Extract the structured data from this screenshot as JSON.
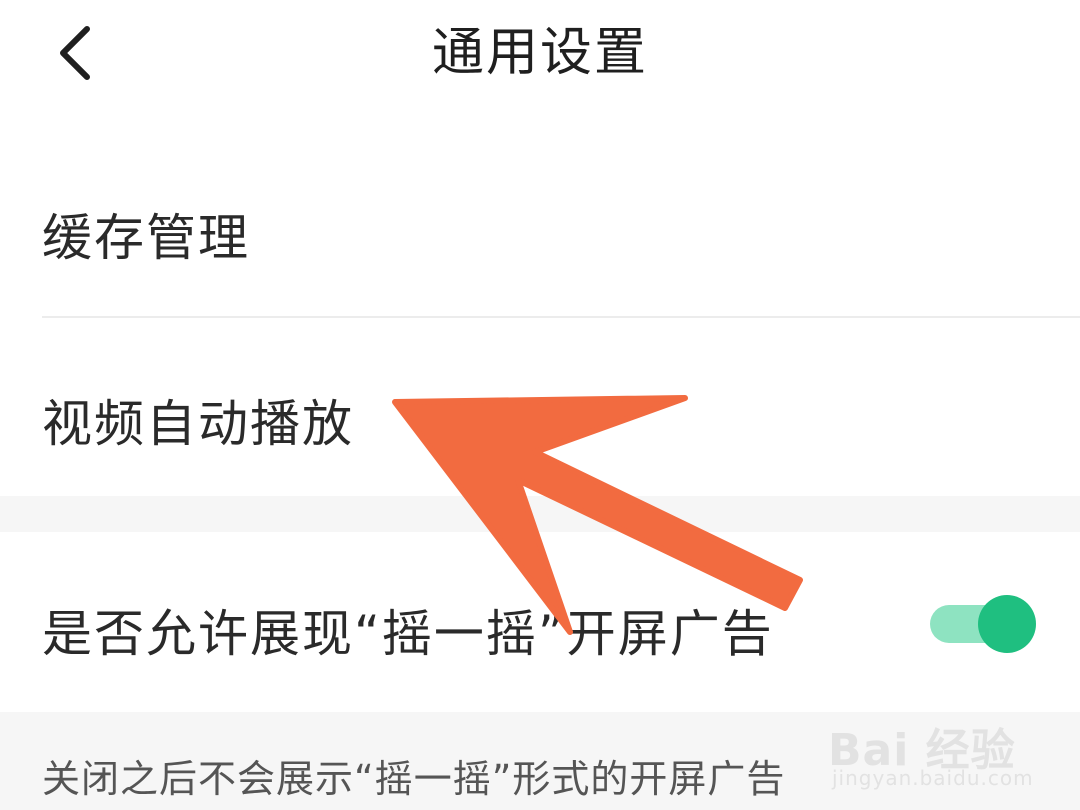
{
  "header": {
    "title": "通用设置",
    "back_icon": "chevron-left-icon"
  },
  "rows": [
    {
      "label": "缓存管理"
    },
    {
      "label": "视频自动播放"
    },
    {
      "label": "是否允许展现“摇一摇”开屏广告",
      "toggle": {
        "state": "on",
        "track_color": "#8EE3C1",
        "knob_color": "#1FBF80"
      }
    }
  ],
  "note": "关闭之后不会展示“摇一摇”形式的开屏广告",
  "annotation": {
    "arrow_color": "#F26B40"
  },
  "watermark": {
    "logo": "Bai 经验",
    "url": "jingyan.baidu.com"
  }
}
